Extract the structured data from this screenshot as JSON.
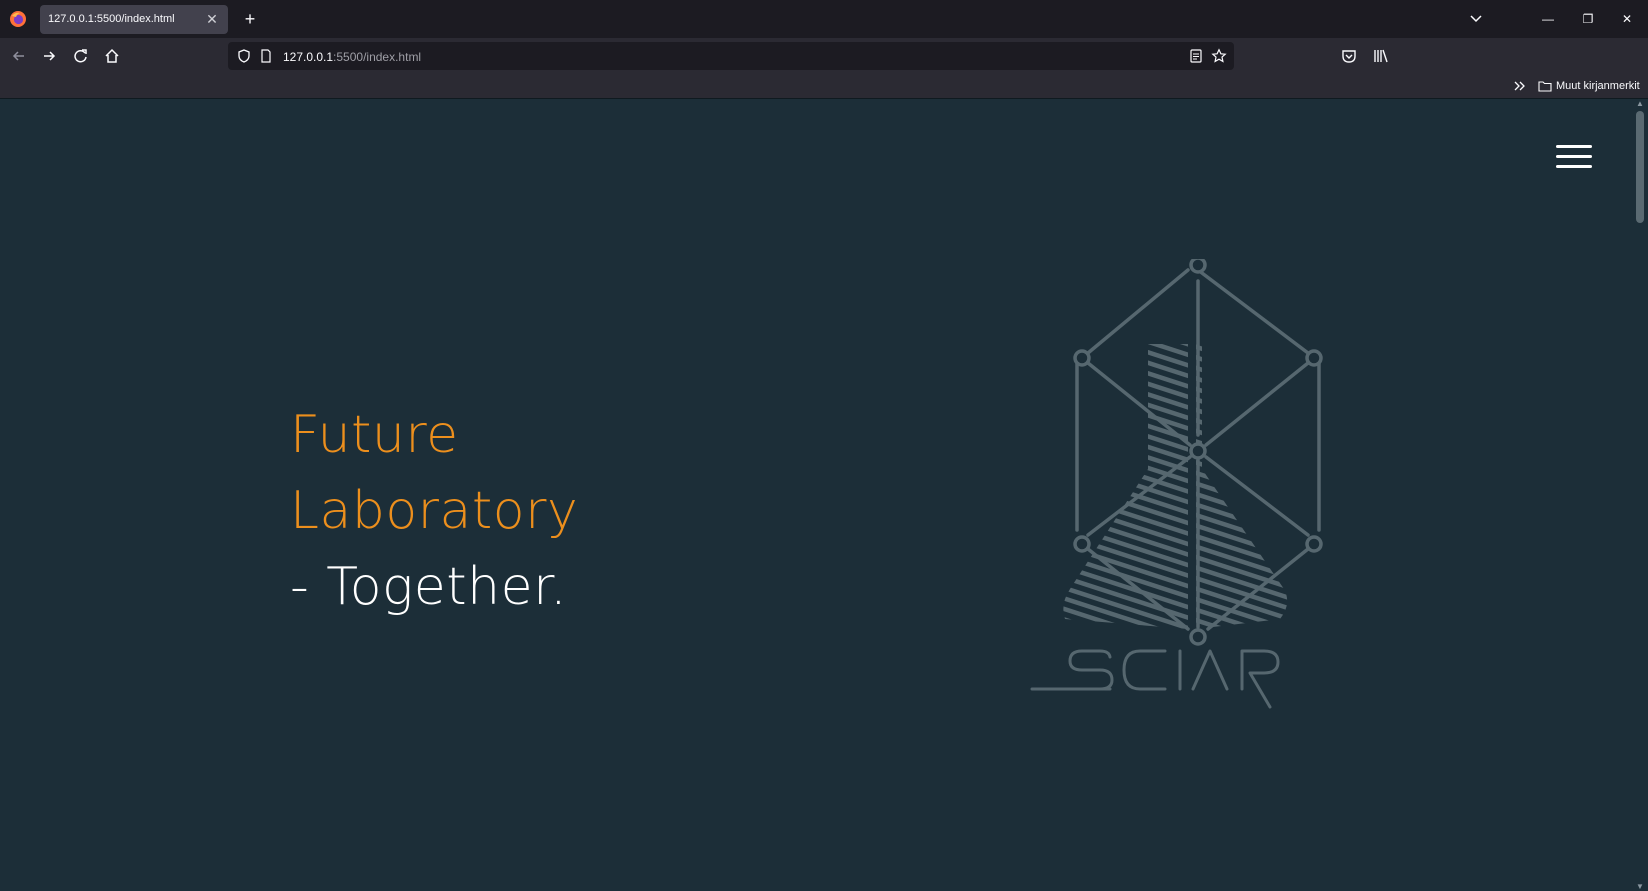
{
  "browser": {
    "tab": {
      "title": "127.0.0.1:5500/index.html"
    },
    "url": {
      "host": "127.0.0.1",
      "rest": ":5500/index.html"
    },
    "bookmarks": {
      "other_label": "Muut kirjanmerkit"
    }
  },
  "page": {
    "hero": {
      "line1": "Future",
      "line2": "Laboratory",
      "line3": "- Together."
    },
    "logo_text": "SCIAR",
    "colors": {
      "background": "#1c2e38",
      "accent": "#ec8f1d",
      "logo": "#56676f"
    }
  }
}
